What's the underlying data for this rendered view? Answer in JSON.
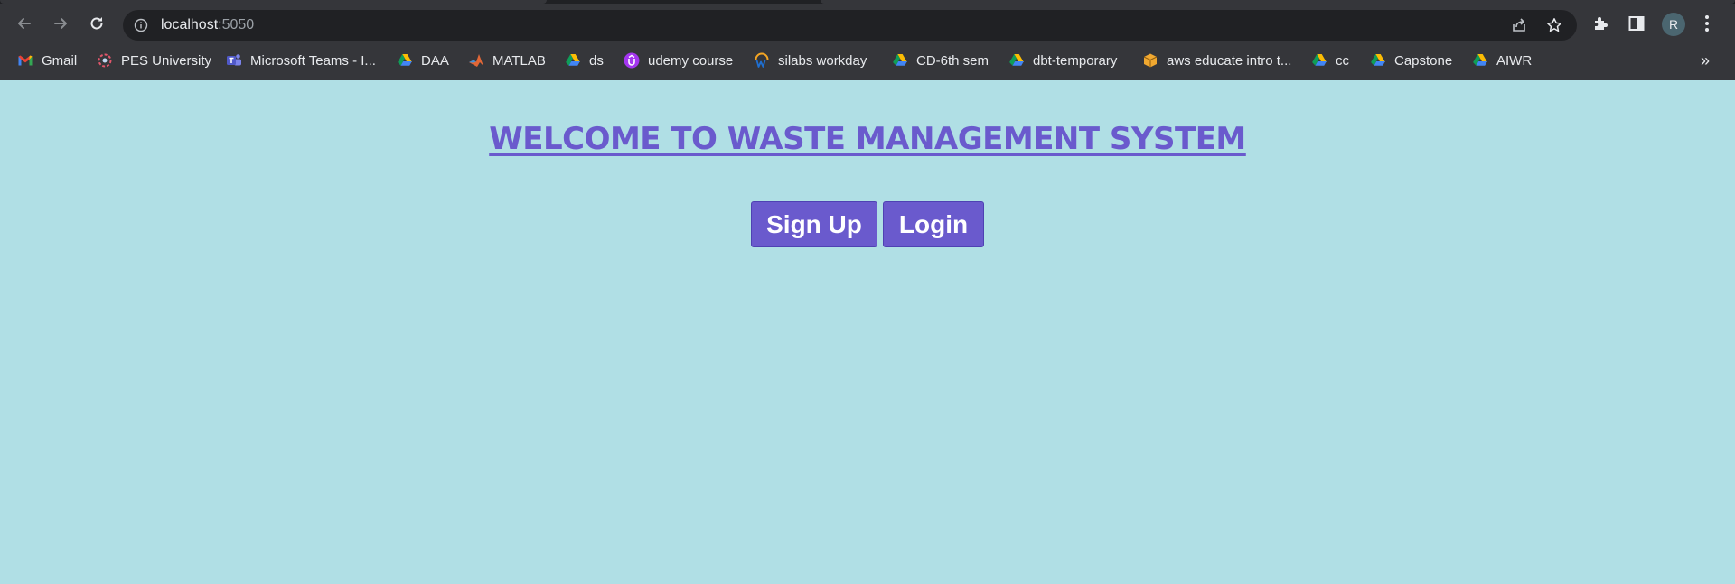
{
  "browser": {
    "address_bar": {
      "host": "localhost",
      "port": ":5050"
    },
    "profile_initial": "R",
    "bookmarks": [
      {
        "label": "Gmail",
        "icon": "gmail-icon"
      },
      {
        "label": "PES University",
        "icon": "pes-university-icon"
      },
      {
        "label": "Microsoft Teams - I...",
        "icon": "teams-icon"
      },
      {
        "label": "DAA",
        "icon": "google-drive-icon"
      },
      {
        "label": "MATLAB",
        "icon": "matlab-icon"
      },
      {
        "label": "ds",
        "icon": "google-drive-icon"
      },
      {
        "label": "udemy course",
        "icon": "udemy-icon"
      },
      {
        "label": "silabs workday",
        "icon": "workday-icon"
      },
      {
        "label": "CD-6th sem",
        "icon": "google-drive-icon"
      },
      {
        "label": "dbt-temporary",
        "icon": "google-drive-icon"
      },
      {
        "label": "aws educate intro t...",
        "icon": "aws-box-icon"
      },
      {
        "label": "cc",
        "icon": "google-drive-icon"
      },
      {
        "label": "Capstone",
        "icon": "google-drive-icon"
      },
      {
        "label": "AIWR",
        "icon": "google-drive-icon"
      }
    ],
    "bookmarks_overflow": "»"
  },
  "page": {
    "title": "WELCOME TO WASTE MANAGEMENT SYSTEM",
    "buttons": {
      "signup_label": "Sign Up",
      "login_label": "Login"
    }
  },
  "colors": {
    "page_background": "#b0dfe5",
    "accent": "#6a5acd",
    "chrome_background": "#35363a",
    "omnibox_background": "#202124"
  }
}
